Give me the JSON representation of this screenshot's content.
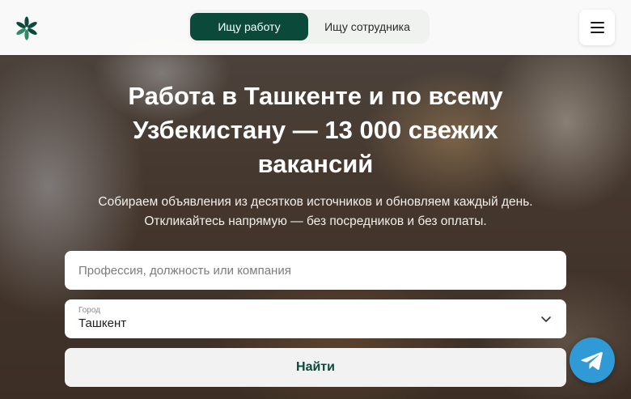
{
  "header": {
    "logo_icon": "asterisk-flower-logo",
    "switch": {
      "active_label": "Ищу работу",
      "inactive_label": "Ищу сотрудника"
    },
    "menu_icon": "hamburger-menu-icon"
  },
  "hero": {
    "title": "Работа в Ташкенте и по всему Узбекистану — 13 000 свежих вакансий",
    "subtitle_line1": "Собираем объявления из десятков источников и обновляем каждый день.",
    "subtitle_line2": "Откликайтесь напрямую — без посредников и без оплаты."
  },
  "search": {
    "placeholder": "Профессия, должность или компания",
    "value": ""
  },
  "city": {
    "label": "Город",
    "value": "Ташкент"
  },
  "find_button": {
    "label": "Найти"
  },
  "floating": {
    "icon": "telegram-icon"
  },
  "colors": {
    "brand_green": "#0b4a3b",
    "telegram_blue": "#2f9ad6"
  }
}
